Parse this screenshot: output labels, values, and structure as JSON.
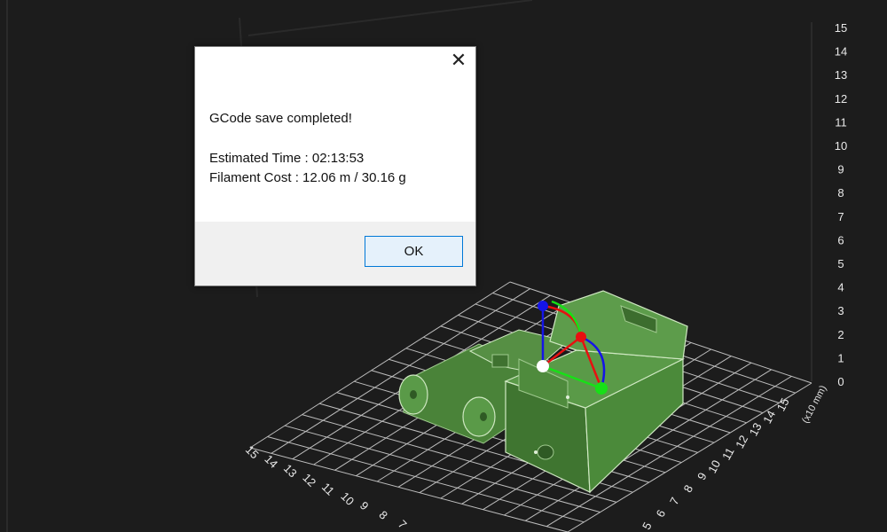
{
  "dialog": {
    "close_glyph": "✕",
    "message": "GCode save completed!",
    "estimated_time": "Estimated Time : 02:13:53",
    "filament_cost": "Filament Cost : 12.06 m / 30.16 g",
    "ok_label": "OK"
  },
  "axes": {
    "z_ticks": [
      "15",
      "14",
      "13",
      "12",
      "11",
      "10",
      "9",
      "8",
      "7",
      "6",
      "5",
      "4",
      "3",
      "2",
      "1",
      "0"
    ],
    "right_ticks": [
      "15",
      "14",
      "13",
      "12",
      "11",
      "10",
      "9",
      "8",
      "7",
      "6",
      "5"
    ],
    "right_unit": "(x10 mm)",
    "left_ticks": [
      "15",
      "14",
      "13",
      "12",
      "11",
      "10",
      "9",
      "8",
      "7"
    ]
  },
  "colors": {
    "background": "#1c1c1c",
    "grid": "#bdbdbd",
    "model": "#4e8a3e",
    "model_edge": "#cfe8c2",
    "gizmo_x": "#e81010",
    "gizmo_y": "#17e017",
    "gizmo_z": "#1414e8"
  }
}
